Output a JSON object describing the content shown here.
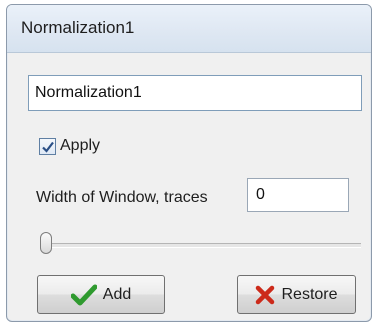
{
  "window": {
    "title": "Normalization1"
  },
  "form": {
    "name_value": "Normalization1",
    "apply_label": "Apply",
    "apply_checked": true,
    "width_label": "Width of Window, traces",
    "width_value": "0",
    "slider_value": 0
  },
  "buttons": {
    "add_label": "Add",
    "add_icon": "checkmark-icon",
    "restore_label": "Restore",
    "restore_icon": "x-icon"
  },
  "colors": {
    "check_green": "#2f9a2f",
    "restore_red": "#cc2a1a"
  }
}
